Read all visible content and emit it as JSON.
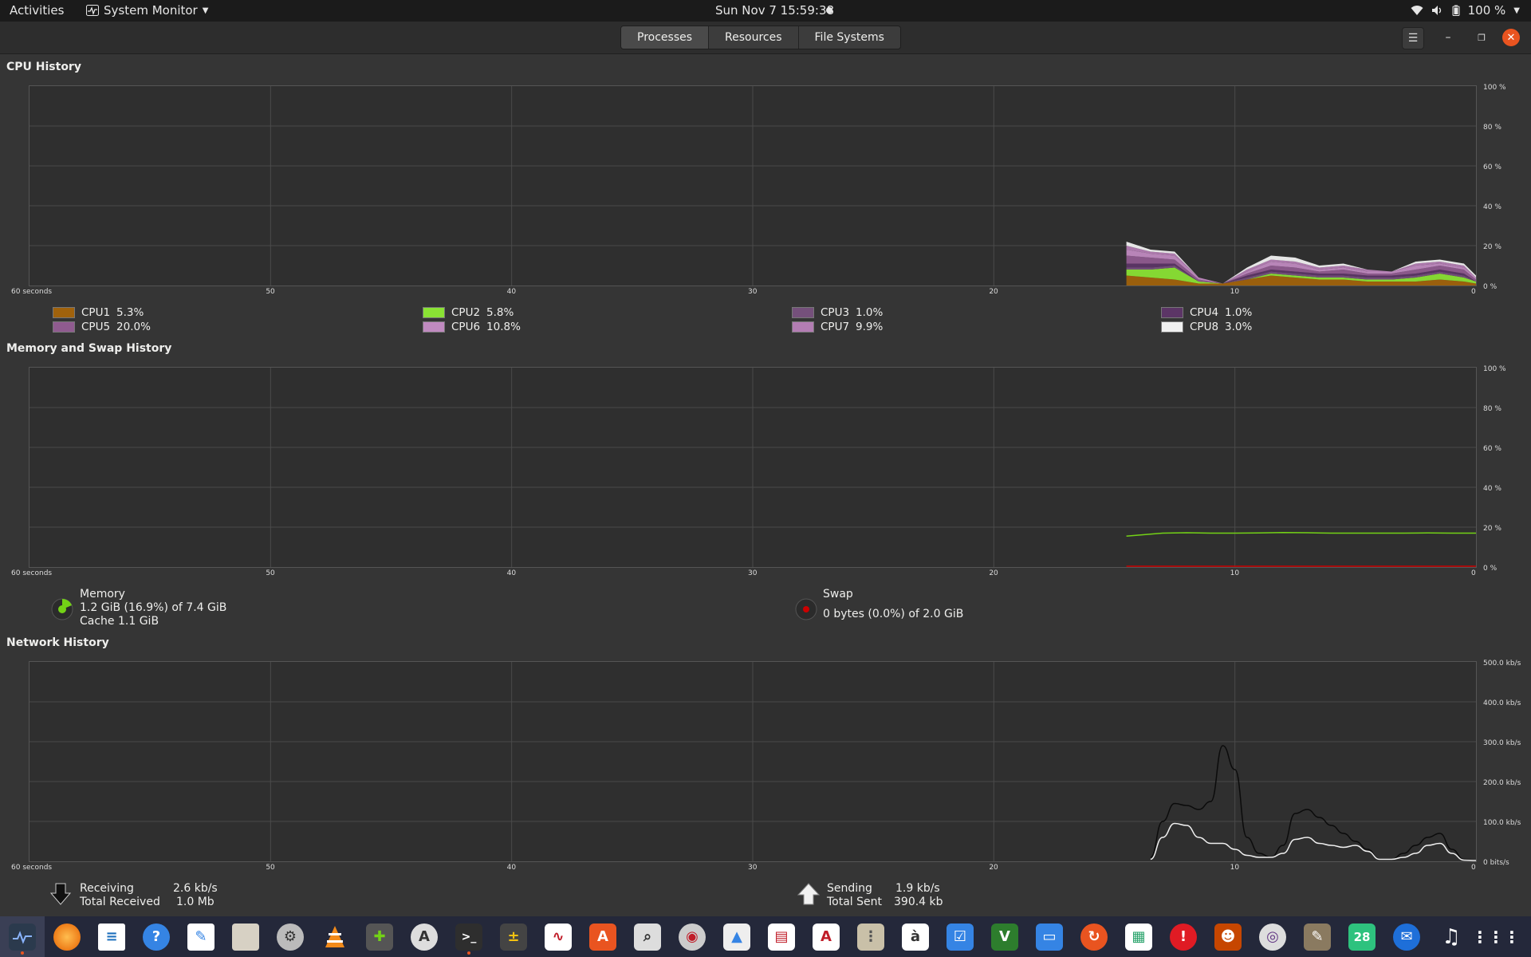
{
  "topbar": {
    "activities": "Activities",
    "app_name": "System Monitor",
    "clock": "Sun Nov 7  15:59:38",
    "battery": "100 %"
  },
  "tabs": [
    {
      "label": "Processes",
      "active": true
    },
    {
      "label": "Resources",
      "active": false
    },
    {
      "label": "File Systems",
      "active": false
    }
  ],
  "cpu": {
    "title": "CPU History",
    "x_ticks": [
      "60 seconds",
      "50",
      "40",
      "30",
      "20",
      "10",
      "0"
    ],
    "y_ticks": [
      "100 %",
      "80 %",
      "60 %",
      "40 %",
      "20 %",
      "0 %"
    ],
    "cores": [
      {
        "label": "CPU1",
        "value": "5.3%",
        "color": "#a0620c"
      },
      {
        "label": "CPU2",
        "value": "5.8%",
        "color": "#8ae234"
      },
      {
        "label": "CPU3",
        "value": "1.0%",
        "color": "#75507b"
      },
      {
        "label": "CPU4",
        "value": "1.0%",
        "color": "#5c3566"
      },
      {
        "label": "CPU5",
        "value": "20.0%",
        "color": "#8f5b8f"
      },
      {
        "label": "CPU6",
        "value": "10.8%",
        "color": "#c08ac0"
      },
      {
        "label": "CPU7",
        "value": "9.9%",
        "color": "#b37db3"
      },
      {
        "label": "CPU8",
        "value": "3.0%",
        "color": "#f0f0f0"
      }
    ]
  },
  "memory": {
    "title": "Memory and Swap History",
    "x_ticks": [
      "60 seconds",
      "50",
      "40",
      "30",
      "20",
      "10",
      "0"
    ],
    "y_ticks": [
      "100 %",
      "80 %",
      "60 %",
      "40 %",
      "20 %",
      "0 %"
    ],
    "mem_label": "Memory",
    "mem_value": "1.2 GiB (16.9%) of 7.4 GiB",
    "cache_value": "Cache 1.1 GiB",
    "swap_label": "Swap",
    "swap_value": "0 bytes (0.0%) of 2.0 GiB",
    "mem_color": "#73d216",
    "swap_color": "#cc0000"
  },
  "network": {
    "title": "Network History",
    "x_ticks": [
      "60 seconds",
      "50",
      "40",
      "30",
      "20",
      "10",
      "0"
    ],
    "y_ticks": [
      "500.0 kb/s",
      "400.0 kb/s",
      "300.0 kb/s",
      "200.0 kb/s",
      "100.0 kb/s",
      "0 bits/s"
    ],
    "receiving_label": "Receiving",
    "receiving_value": "2.6 kb/s",
    "total_received_label": "Total Received",
    "total_received_value": "1.0 Mb",
    "sending_label": "Sending",
    "sending_value": "1.9 kb/s",
    "total_sent_label": "Total Sent",
    "total_sent_value": "390.4 kb"
  },
  "chart_data": [
    {
      "type": "area",
      "title": "CPU History",
      "xlabel": "seconds",
      "x": [
        14.5,
        13.5,
        12.5,
        11.5,
        10.5,
        9.5,
        8.5,
        7.5,
        6.5,
        5.5,
        4.5,
        3.5,
        2.5,
        1.5,
        0.5,
        0
      ],
      "xlim": [
        60,
        0
      ],
      "ylim": [
        0,
        100
      ],
      "stacked": true,
      "series": [
        {
          "name": "CPU1",
          "values": [
            5,
            4,
            3,
            1,
            1,
            3,
            5,
            4,
            3,
            3,
            2,
            2,
            2,
            3,
            2,
            1
          ]
        },
        {
          "name": "CPU2",
          "values": [
            3,
            4,
            6,
            1,
            0,
            0,
            1,
            1,
            1,
            1,
            1,
            1,
            2,
            3,
            2,
            1
          ]
        },
        {
          "name": "CPU3",
          "values": [
            1,
            1,
            1,
            0,
            0,
            1,
            1,
            1,
            1,
            1,
            1,
            1,
            1,
            1,
            1,
            0
          ]
        },
        {
          "name": "CPU4",
          "values": [
            2,
            2,
            1,
            0,
            0,
            1,
            1,
            1,
            1,
            1,
            1,
            1,
            1,
            1,
            1,
            0
          ]
        },
        {
          "name": "CPU5",
          "values": [
            4,
            3,
            2,
            1,
            0,
            1,
            2,
            2,
            1,
            2,
            1,
            1,
            2,
            2,
            2,
            1
          ]
        },
        {
          "name": "CPU6",
          "values": [
            3,
            2,
            2,
            1,
            0,
            1,
            2,
            2,
            1,
            1,
            1,
            1,
            2,
            1,
            1,
            1
          ]
        },
        {
          "name": "CPU7",
          "values": [
            2,
            1,
            1,
            0,
            0,
            1,
            1,
            1,
            1,
            1,
            1,
            0,
            1,
            1,
            1,
            0
          ]
        },
        {
          "name": "CPU8",
          "values": [
            2,
            1,
            1,
            0,
            0,
            1,
            2,
            2,
            1,
            1,
            0,
            0,
            1,
            1,
            1,
            1
          ]
        }
      ]
    },
    {
      "type": "line",
      "title": "Memory and Swap History",
      "x": [
        14.5,
        14,
        13,
        12,
        11,
        10,
        9,
        8,
        7,
        6,
        5,
        4,
        3,
        2,
        1,
        0
      ],
      "xlim": [
        60,
        0
      ],
      "ylim": [
        0,
        100
      ],
      "series": [
        {
          "name": "Memory",
          "values": [
            15.5,
            16,
            17,
            17.2,
            17,
            17,
            17.1,
            17.3,
            17.2,
            17,
            17,
            17,
            17,
            17.1,
            17,
            17
          ]
        },
        {
          "name": "Swap",
          "values": [
            0,
            0,
            0,
            0,
            0,
            0,
            0,
            0,
            0,
            0,
            0,
            0,
            0,
            0,
            0,
            0
          ]
        }
      ]
    },
    {
      "type": "line",
      "title": "Network History",
      "x": [
        13.5,
        13,
        12.5,
        12,
        11.5,
        11,
        10.5,
        10,
        9.5,
        9,
        8.5,
        8,
        7.5,
        7,
        6.5,
        6,
        5.5,
        5,
        4.5,
        4,
        3.5,
        3,
        2.5,
        2,
        1.5,
        1,
        0.5,
        0
      ],
      "xlim": [
        60,
        0
      ],
      "ylim": [
        0,
        500
      ],
      "series": [
        {
          "name": "Receiving",
          "values": [
            10,
            100,
            145,
            140,
            130,
            150,
            290,
            230,
            60,
            20,
            10,
            40,
            120,
            130,
            110,
            90,
            70,
            50,
            30,
            5,
            5,
            20,
            40,
            60,
            70,
            30,
            5,
            2
          ]
        },
        {
          "name": "Sending",
          "values": [
            5,
            60,
            95,
            90,
            60,
            45,
            45,
            30,
            15,
            10,
            10,
            20,
            55,
            60,
            45,
            40,
            35,
            40,
            25,
            5,
            5,
            10,
            20,
            40,
            45,
            20,
            3,
            2
          ]
        }
      ]
    }
  ]
}
